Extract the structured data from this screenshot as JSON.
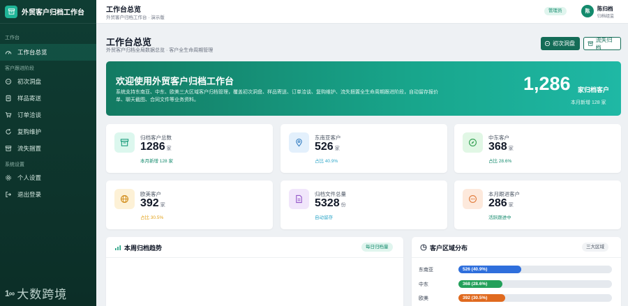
{
  "app": {
    "title": "外贸客户归档工作台"
  },
  "sidebar": {
    "sections": [
      {
        "title": "工作台"
      },
      {
        "title": "客户跟进阶段"
      },
      {
        "title": "系统设置"
      }
    ],
    "items": [
      {
        "label": "工作台总览",
        "icon": "dashboard-icon",
        "active": true
      },
      {
        "label": "初次洞盘",
        "icon": "chat-icon"
      },
      {
        "label": "样品寄送",
        "icon": "document-icon"
      },
      {
        "label": "订单洽谈",
        "icon": "cart-icon"
      },
      {
        "label": "复购维护",
        "icon": "refresh-icon"
      },
      {
        "label": "流失捆置",
        "icon": "archive-icon"
      },
      {
        "label": "个人设置",
        "icon": "gear-icon"
      },
      {
        "label": "退出登录",
        "icon": "logout-icon"
      }
    ],
    "footer": {
      "mark": "1∞",
      "text": "大数跨境"
    }
  },
  "topbar": {
    "title": "工作台总览",
    "subtitle": "外贸客户归档工作台 · 演示版",
    "role_badge": "管理员",
    "user": {
      "avatar": "陈",
      "name": "陈归档",
      "role": "归档组监"
    }
  },
  "page": {
    "title": "工作台总览",
    "subtitle": "外贸客户归档全局数据总览 · 客户全生命周期管理",
    "buttons": {
      "primary": "初次洞盘",
      "secondary": "流失归档"
    }
  },
  "banner": {
    "title": "欢迎使用外贸客户归档工作台",
    "description": "系统支持东南亚、中东、欧美三大区域客户归档管理，覆盖初次洞盘、样品寄送、订单洽谈、复购维护、流失捆置全生命周期跟进阶段，自动留存报价单、聊天截图、合同文件等业务资料。",
    "number": "1,286",
    "unit": "家归档客户",
    "footnote": "本月新增 128 家"
  },
  "stats": [
    {
      "label": "归档客户总数",
      "value": "1286",
      "unit": "家",
      "note": "本月新增 128 家",
      "icon": "archive-icon",
      "icon_bg": "#dcf7ee",
      "icon_color": "#1a9c7c",
      "note_color": "#138a6c"
    },
    {
      "label": "东南亚客户",
      "value": "526",
      "unit": "家",
      "note": "占比 40.9%",
      "icon": "location-pin-icon",
      "icon_bg": "#e3f0fc",
      "icon_color": "#3b82c4",
      "note_color": "#2fa7c9"
    },
    {
      "label": "中东客户",
      "value": "368",
      "unit": "家",
      "note": "占比 28.6%",
      "icon": "compass-icon",
      "icon_bg": "#e1f7e5",
      "icon_color": "#2f9e4f",
      "note_color": "#138a6c"
    },
    {
      "label": "欧美客户",
      "value": "392",
      "unit": "家",
      "note": "占比 30.5%",
      "icon": "globe-icon",
      "icon_bg": "#fdf1d6",
      "icon_color": "#d08a16",
      "note_color": "#e3a21a"
    },
    {
      "label": "归档文件总量",
      "value": "5328",
      "unit": "份",
      "note": "自动留存",
      "icon": "file-icon",
      "icon_bg": "#f1e6fb",
      "icon_color": "#9457c9",
      "note_color": "#2fa7c9"
    },
    {
      "label": "本月跟进客户",
      "value": "286",
      "unit": "家",
      "note": "活跃跟进中",
      "icon": "message-icon",
      "icon_bg": "#fde9dc",
      "icon_color": "#e07a3a",
      "note_color": "#138a6c"
    }
  ],
  "panels": {
    "trend": {
      "title": "本周归档趋势",
      "badge": "每日归档量"
    },
    "region": {
      "title": "客户区域分布",
      "badge": "三大区域",
      "rows": [
        {
          "name": "东南亚",
          "label": "526 (40.9%)",
          "fraction": 0.409,
          "color": "#2f6fdc"
        },
        {
          "name": "中东",
          "label": "368 (28.6%)",
          "fraction": 0.286,
          "color": "#23a05a"
        },
        {
          "name": "欧美",
          "label": "392 (30.5%)",
          "fraction": 0.305,
          "color": "#e06a1f"
        }
      ]
    }
  }
}
